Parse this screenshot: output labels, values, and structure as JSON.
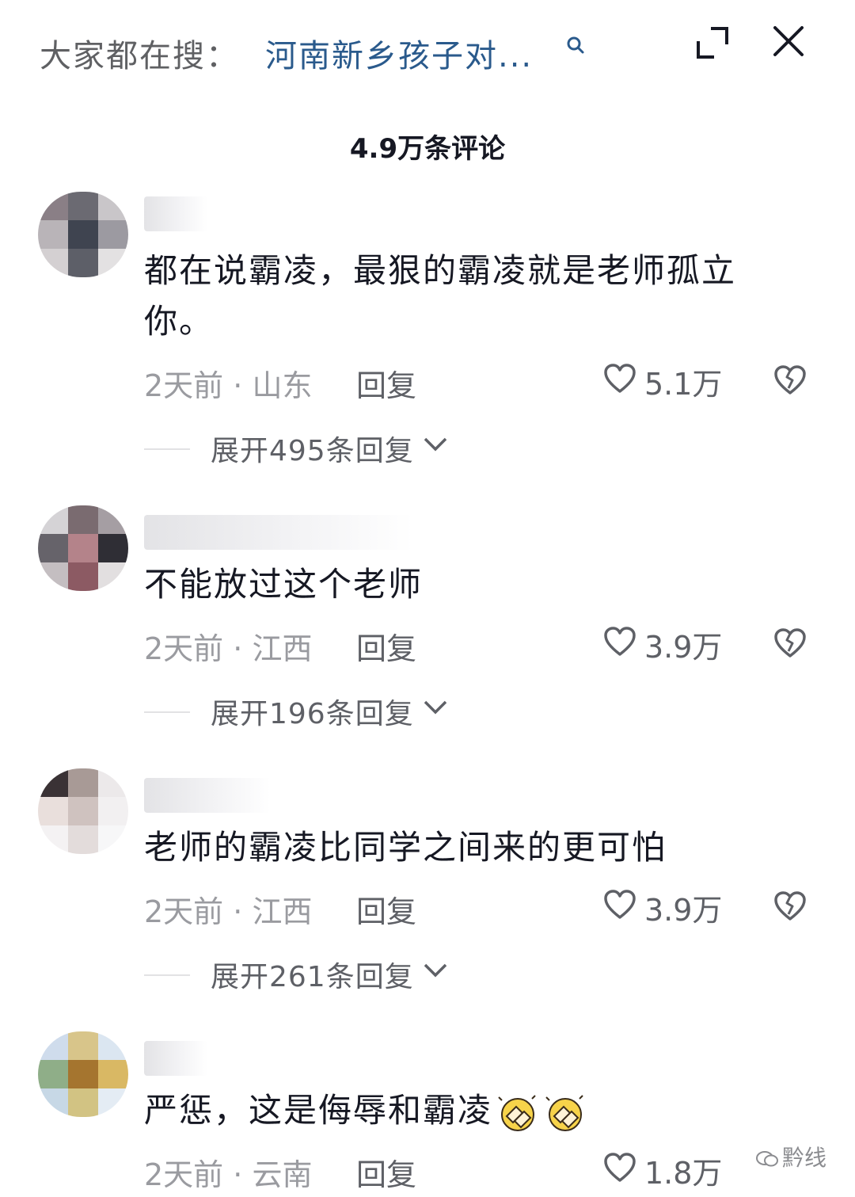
{
  "header": {
    "search_prefix": "大家都在搜：",
    "search_query": "河南新乡孩子对...",
    "comment_count_title": "4.9万条评论"
  },
  "comments": [
    {
      "text": "都在说霸凌，最狠的霸凌就是老师孤立你。",
      "time": "2天前",
      "location": "山东",
      "reply_label": "回复",
      "likes": "5.1万",
      "expand_label": "展开495条回复"
    },
    {
      "text": "不能放过这个老师",
      "time": "2天前",
      "location": "江西",
      "reply_label": "回复",
      "likes": "3.9万",
      "expand_label": "展开196条回复"
    },
    {
      "text": "老师的霸凌比同学之间来的更可怕",
      "time": "2天前",
      "location": "江西",
      "reply_label": "回复",
      "likes": "3.9万",
      "expand_label": "展开261条回复"
    },
    {
      "text": "严惩，这是侮辱和霸凌",
      "time": "2天前",
      "location": "云南",
      "reply_label": "回复",
      "likes": "1.8万"
    }
  ],
  "watermark": "黔线",
  "colors": {
    "search_link": "#2a5a8c",
    "meta_gray": "#9a9ba0",
    "text_dark": "#161823"
  }
}
